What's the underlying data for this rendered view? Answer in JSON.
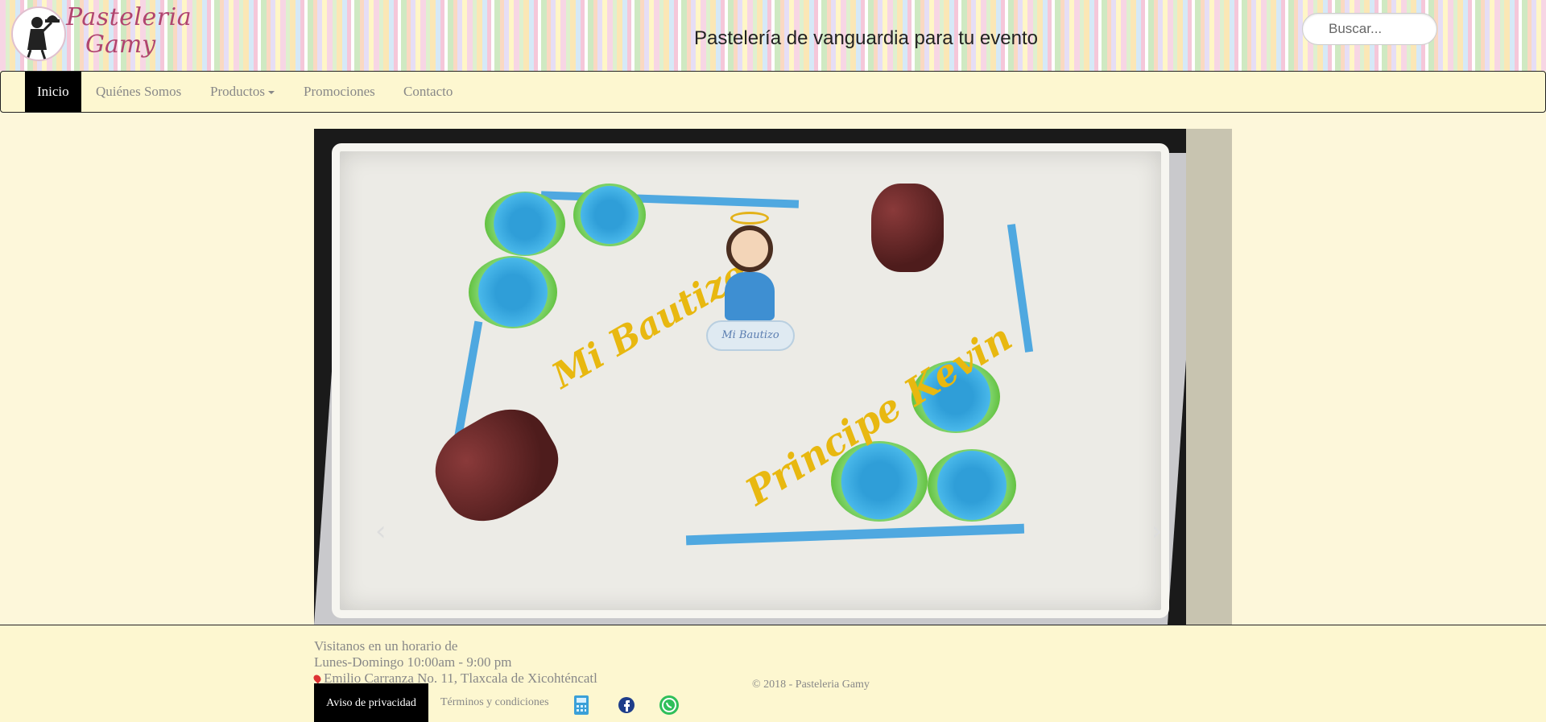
{
  "header": {
    "logo_line1": "Pasteleria",
    "logo_line2": "Gamy",
    "tagline": "Pastelería de vanguardia para tu evento",
    "search_placeholder": "Buscar..."
  },
  "nav": {
    "items": [
      {
        "label": "Inicio",
        "active": true
      },
      {
        "label": "Quiénes Somos"
      },
      {
        "label": "Productos"
      },
      {
        "label": "Promociones"
      },
      {
        "label": "Contacto"
      }
    ]
  },
  "carousel": {
    "prev_icon": "chevron-left-icon",
    "next_icon": "chevron-right-icon",
    "slide": {
      "cake_text1": "Mi Bautizo",
      "cake_text2": "Principe Kevin",
      "cloud_text": "Mi Bautizo"
    }
  },
  "footer": {
    "hours_line1": "Visitanos en un horario de",
    "hours_line2": "Lunes-Domingo 10:00am - 9:00 pm",
    "address": "Emilio Carranza No. 11, Tlaxcala de Xicohténcatl",
    "privacy_label": "Aviso de privacidad",
    "terms_label": "Términos y condiciones",
    "copyright": "© 2018 - Pasteleria Gamy",
    "social_icons": [
      "calculator-phone-icon",
      "facebook-icon",
      "whatsapp-icon"
    ]
  },
  "colors": {
    "page_bg": "#fdf7da",
    "nav_bg": "#fdf7d0",
    "active_nav": "#000000",
    "logo_pink": "#b0456f"
  }
}
